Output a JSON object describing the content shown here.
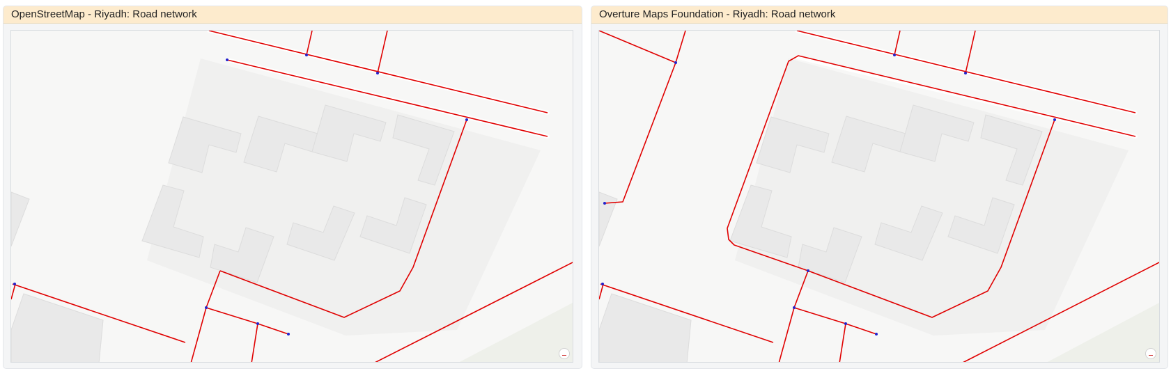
{
  "panels": [
    {
      "title": "OpenStreetMap - Riyadh: Road network"
    },
    {
      "title": "Overture Maps Foundation - Riyadh: Road network"
    }
  ],
  "colors": {
    "road": "#e00000",
    "node": "#2222cc",
    "building_fill": "#e9e9e9",
    "building_stroke": "#d9d9d9",
    "campus": "#f0f0ef",
    "background": "#f7f7f6",
    "park": "#eef0ea",
    "header_bg": "#fdebcd"
  },
  "icons": {
    "attribution": "map-attribution-icon"
  }
}
